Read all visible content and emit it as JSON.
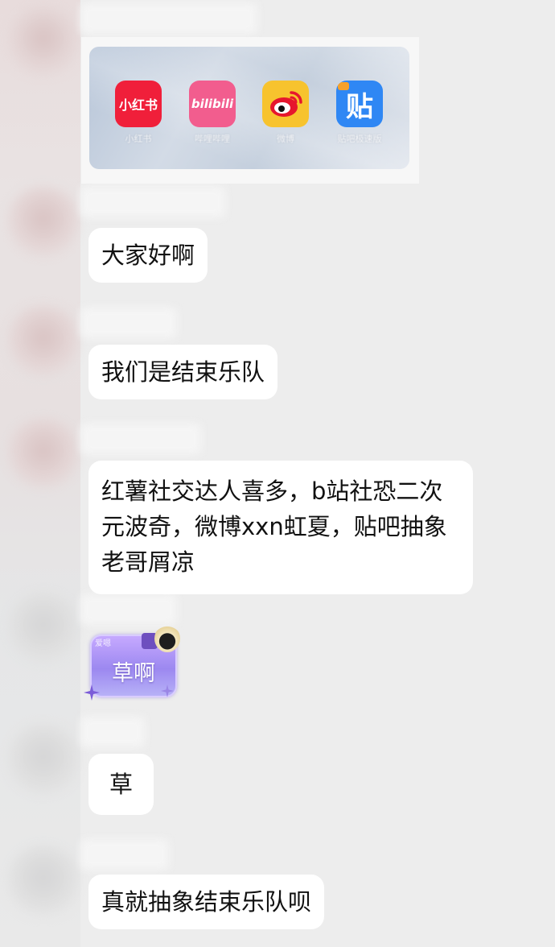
{
  "apps_card": {
    "apps": [
      {
        "label": "小红书",
        "icon_text": "小红书",
        "icon": "xiaohongshu-icon",
        "color": "#f01f3a"
      },
      {
        "label": "哔哩哔哩",
        "icon_text": "bilibili",
        "icon": "bilibili-icon",
        "color": "#f25d8e"
      },
      {
        "label": "微博",
        "icon_text": "",
        "icon": "weibo-icon",
        "color": "#f7c32e"
      },
      {
        "label": "贴吧极速版",
        "icon_text": "贴",
        "icon": "tieba-icon",
        "color": "#2f87f4"
      }
    ]
  },
  "messages": [
    {
      "text": "大家好啊"
    },
    {
      "text": "我们是结束乐队"
    },
    {
      "lines": [
        "红薯社交达人喜多，b站社恐二次",
        "元波奇，微博xxn虹夏，贴吧抽象",
        "老哥屑凉"
      ]
    },
    {
      "sticker_tag": "爱嗯",
      "sticker_text": "草啊",
      "sticker_icon": "onigiri-icon"
    },
    {
      "text": "草"
    },
    {
      "text": "真就抽象结束乐队呗"
    }
  ]
}
